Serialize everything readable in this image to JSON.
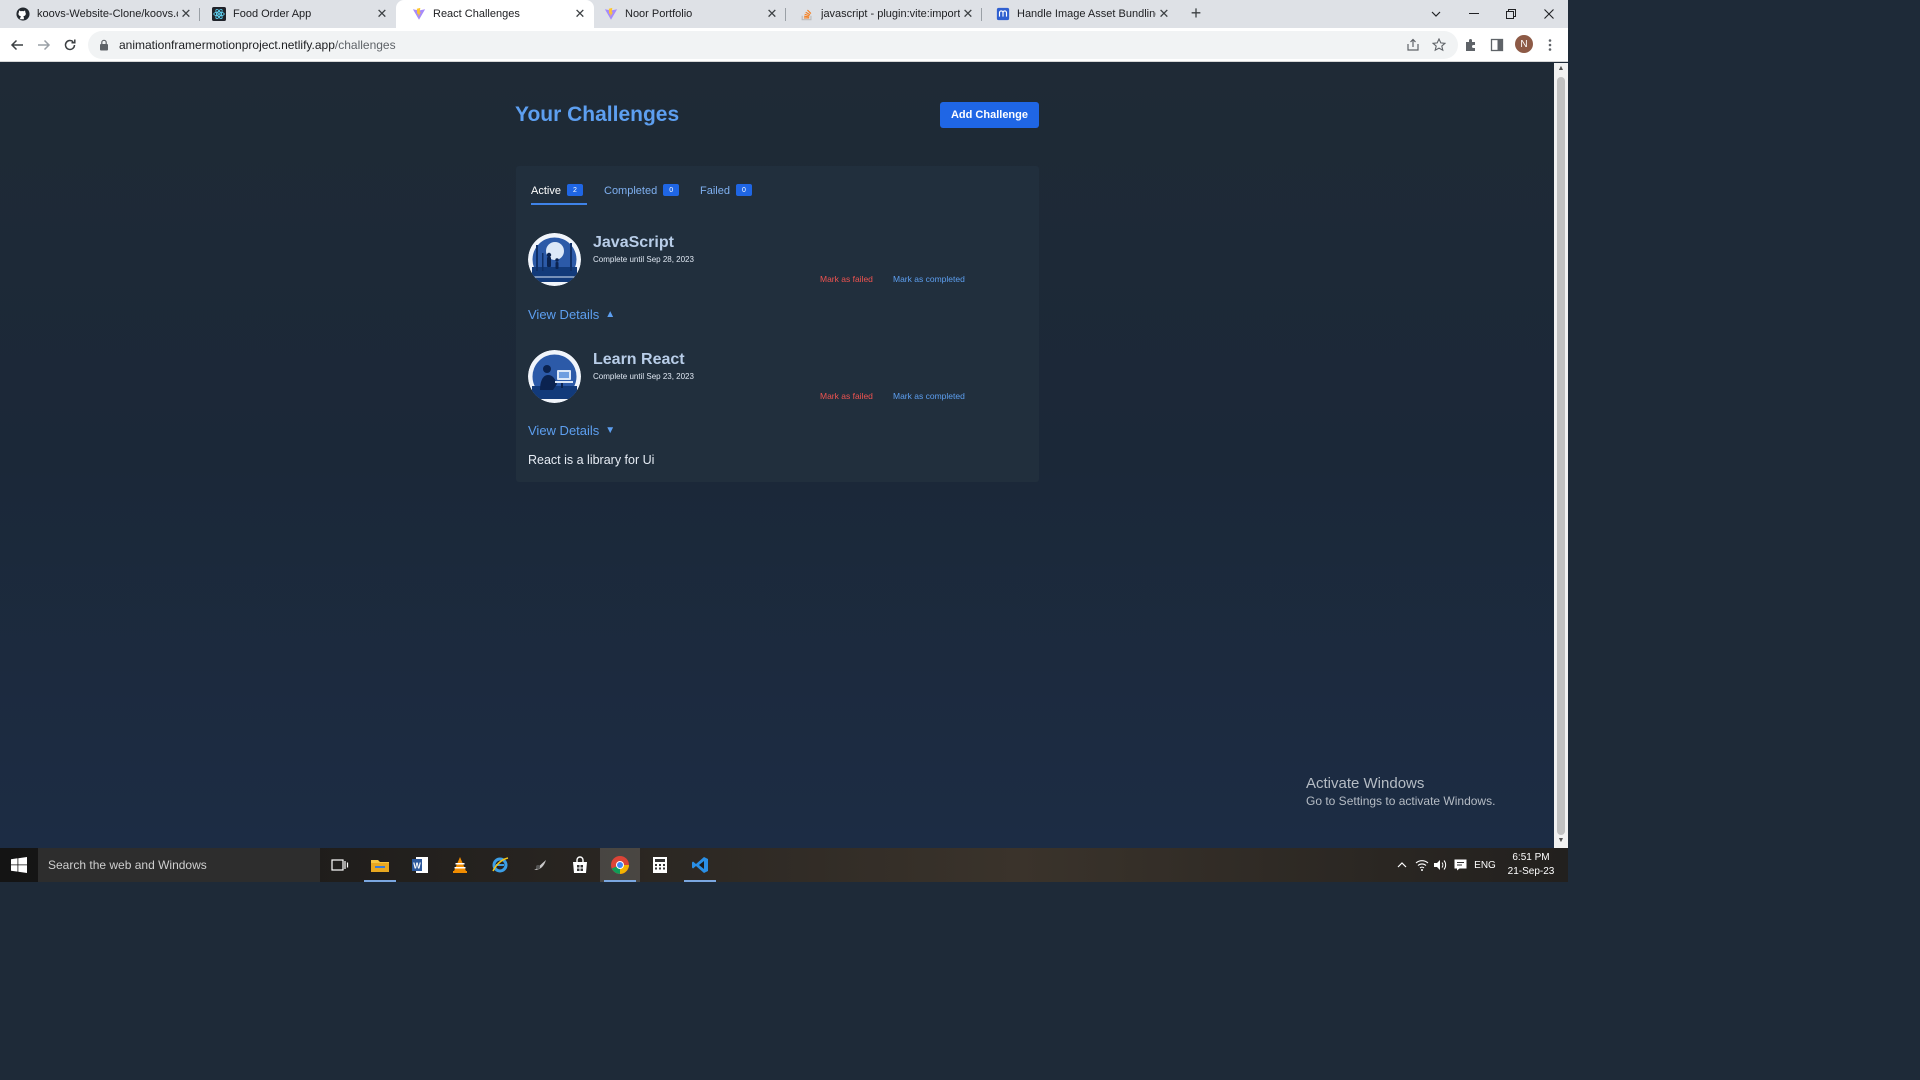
{
  "browser": {
    "tabs": [
      {
        "title": "koovs-Website-Clone/koovs.com",
        "favicon": "github-icon",
        "active": false
      },
      {
        "title": "Food Order App",
        "favicon": "react-icon",
        "active": false
      },
      {
        "title": "React Challenges",
        "favicon": "vite-icon",
        "active": true
      },
      {
        "title": "Noor Portfolio",
        "favicon": "vite-icon",
        "active": false
      },
      {
        "title": "javascript - plugin:vite:import-an",
        "favicon": "stackoverflow-icon",
        "active": false
      },
      {
        "title": "Handle Image Asset Bundling us",
        "favicon": "blog-icon",
        "active": false
      }
    ],
    "close_glyph": "✕",
    "new_tab_glyph": "+",
    "url_host": "animationframermotionproject.netlify.app",
    "url_path": "/challenges",
    "profile_initial": "N"
  },
  "page": {
    "title": "Your Challenges",
    "add_button": "Add Challenge",
    "tabs": [
      {
        "label": "Active",
        "count": "2",
        "active": true
      },
      {
        "label": "Completed",
        "count": "0",
        "active": false
      },
      {
        "label": "Failed",
        "count": "0",
        "active": false
      }
    ],
    "challenges": [
      {
        "title": "JavaScript",
        "due": "Complete until Sep 28, 2023",
        "failed_label": "Mark as failed",
        "completed_label": "Mark as completed",
        "details_label": "View Details",
        "details_arrow": "▲",
        "description": ""
      },
      {
        "title": "Learn React",
        "due": "Complete until Sep 23, 2023",
        "failed_label": "Mark as failed",
        "completed_label": "Mark as completed",
        "details_label": "View Details",
        "details_arrow": "▼",
        "description": "React is a library for Ui"
      }
    ]
  },
  "watermark": {
    "line1": "Activate Windows",
    "line2": "Go to Settings to activate Windows."
  },
  "taskbar": {
    "search_placeholder": "Search the web and Windows",
    "tray_language": "ENG",
    "time": "6:51 PM",
    "date": "21-Sep-23"
  },
  "colors": {
    "accent": "#1f66e5",
    "title_blue": "#5d9ff0",
    "danger": "#ef5350",
    "panel": "#212f3d",
    "page_bg": "#1e2a38"
  }
}
